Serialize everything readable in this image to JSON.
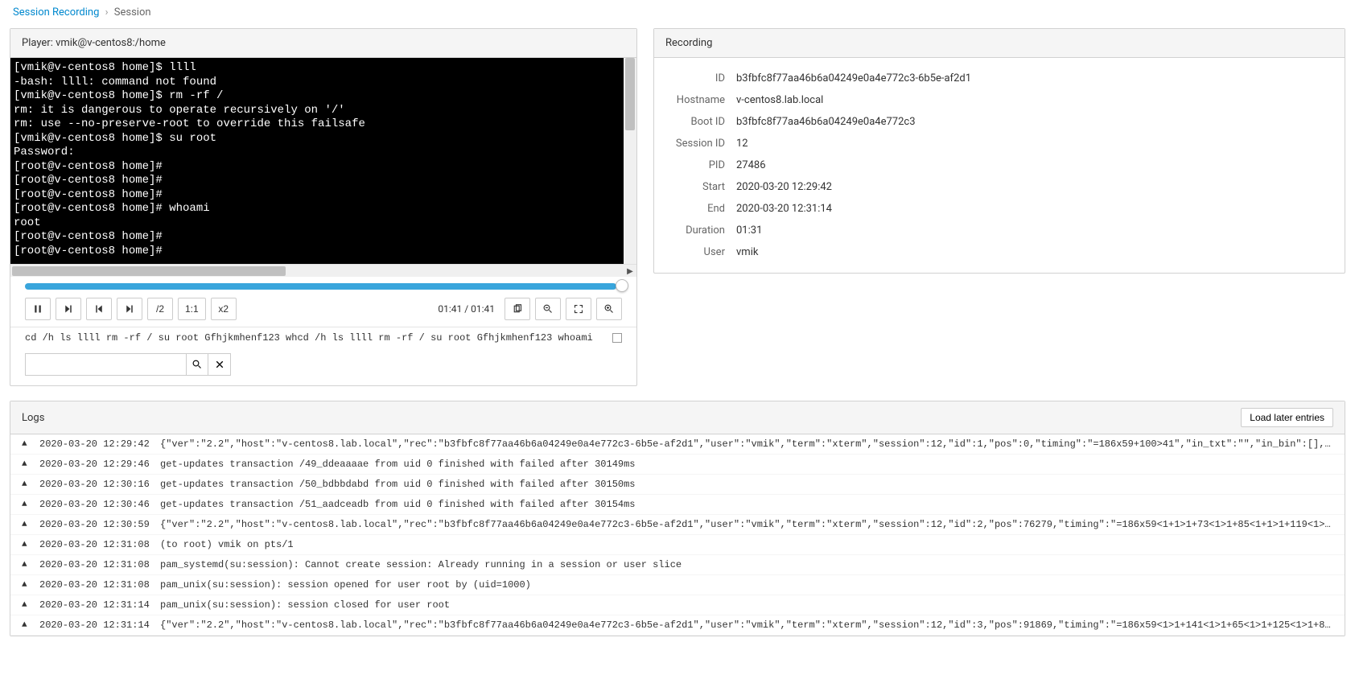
{
  "breadcrumb": {
    "parent": "Session Recording",
    "current": "Session"
  },
  "player": {
    "title": "Player: vmik@v-centos8:/home",
    "terminal_lines": [
      "[vmik@v-centos8 home]$ llll",
      "-bash: llll: command not found",
      "[vmik@v-centos8 home]$ rm -rf /",
      "rm: it is dangerous to operate recursively on '/'",
      "rm: use --no-preserve-root to override this failsafe",
      "[vmik@v-centos8 home]$ su root",
      "Password:",
      "[root@v-centos8 home]#",
      "[root@v-centos8 home]#",
      "[root@v-centos8 home]#",
      "[root@v-centos8 home]# whoami",
      "root",
      "[root@v-centos8 home]#",
      "[root@v-centos8 home]#"
    ],
    "controls": {
      "frac": "/2",
      "ratio": "1:1",
      "speed": "x2",
      "time": "01:41 / 01:41"
    },
    "command_strip": "cd /h   ls llll rm -rf / su root Gfhjkmhenf123    whcd /h      ls llll rm -rf / su root Gfhjkmhenf123    whoami"
  },
  "recording": {
    "title": "Recording",
    "fields": {
      "id_label": "ID",
      "id": "b3fbfc8f77aa46b6a04249e0a4e772c3-6b5e-af2d1",
      "hostname_label": "Hostname",
      "hostname": "v-centos8.lab.local",
      "bootid_label": "Boot ID",
      "bootid": "b3fbfc8f77aa46b6a04249e0a4e772c3",
      "sessionid_label": "Session ID",
      "sessionid": "12",
      "pid_label": "PID",
      "pid": "27486",
      "start_label": "Start",
      "start": "2020-03-20 12:29:42",
      "end_label": "End",
      "end": "2020-03-20 12:31:14",
      "duration_label": "Duration",
      "duration": "01:31",
      "user_label": "User",
      "user": "vmik"
    }
  },
  "logs": {
    "title": "Logs",
    "load_later": "Load later entries",
    "entries": [
      {
        "time": "2020-03-20 12:29:42",
        "msg": "{\"ver\":\"2.2\",\"host\":\"v-centos8.lab.local\",\"rec\":\"b3fbfc8f77aa46b6a04249e0a4e772c3-6b5e-af2d1\",\"user\":\"vmik\",\"term\":\"xterm\",\"session\":12,\"id\":1,\"pos\":0,\"timing\":\"=186x59+100>41\",\"in_txt\":\"\",\"in_bin\":[],\"o…"
      },
      {
        "time": "2020-03-20 12:29:46",
        "msg": "get-updates transaction /49_ddeaaaae from uid 0 finished with failed after 30149ms"
      },
      {
        "time": "2020-03-20 12:30:16",
        "msg": "get-updates transaction /50_bdbbdabd from uid 0 finished with failed after 30150ms"
      },
      {
        "time": "2020-03-20 12:30:46",
        "msg": "get-updates transaction /51_aadceadb from uid 0 finished with failed after 30154ms"
      },
      {
        "time": "2020-03-20 12:30:59",
        "msg": "{\"ver\":\"2.2\",\"host\":\"v-centos8.lab.local\",\"rec\":\"b3fbfc8f77aa46b6a04249e0a4e772c3-6b5e-af2d1\",\"user\":\"vmik\",\"term\":\"xterm\",\"session\":12,\"id\":2,\"pos\":76279,\"timing\":\"=186x59<1+1>1+73<1>1+85<1+1>1+119<1>1+…"
      },
      {
        "time": "2020-03-20 12:31:08",
        "msg": "(to root) vmik on pts/1"
      },
      {
        "time": "2020-03-20 12:31:08",
        "msg": "pam_systemd(su:session): Cannot create session: Already running in a session or user slice"
      },
      {
        "time": "2020-03-20 12:31:08",
        "msg": "pam_unix(su:session): session opened for user root by (uid=1000)"
      },
      {
        "time": "2020-03-20 12:31:14",
        "msg": "pam_unix(su:session): session closed for user root"
      },
      {
        "time": "2020-03-20 12:31:14",
        "msg": "{\"ver\":\"2.2\",\"host\":\"v-centos8.lab.local\",\"rec\":\"b3fbfc8f77aa46b6a04249e0a4e772c3-6b5e-af2d1\",\"user\":\"vmik\",\"term\":\"xterm\",\"session\":12,\"id\":3,\"pos\":91869,\"timing\":\"=186x59<1>1+141<1>1+65<1>1+125<1>1+85<…"
      }
    ]
  }
}
